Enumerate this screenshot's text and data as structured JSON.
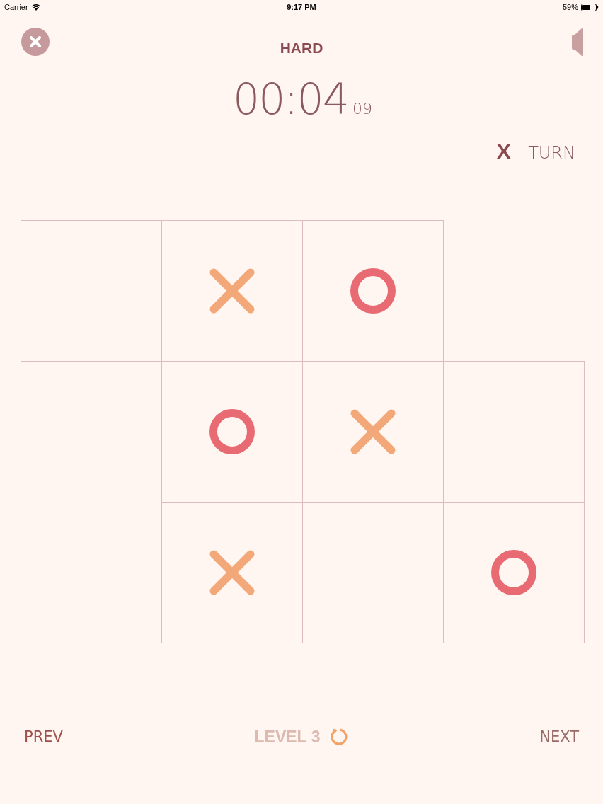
{
  "status_bar": {
    "carrier": "Carrier",
    "time": "9:17 PM",
    "battery": "59%"
  },
  "header": {
    "title": "HARD"
  },
  "timer": {
    "main": "00:04",
    "fraction": "09"
  },
  "turn": {
    "player": "X",
    "label": "- TURN"
  },
  "board": {
    "rows": [
      [
        {
          "kind": "empty"
        },
        {
          "kind": "x"
        },
        {
          "kind": "o"
        },
        {
          "kind": "gap"
        }
      ],
      [
        {
          "kind": "gap"
        },
        {
          "kind": "o"
        },
        {
          "kind": "x"
        },
        {
          "kind": "empty"
        }
      ],
      [
        {
          "kind": "gap"
        },
        {
          "kind": "x"
        },
        {
          "kind": "empty"
        },
        {
          "kind": "o"
        }
      ]
    ]
  },
  "footer": {
    "prev": "PREV",
    "level": "LEVEL 3",
    "next": "NEXT"
  }
}
